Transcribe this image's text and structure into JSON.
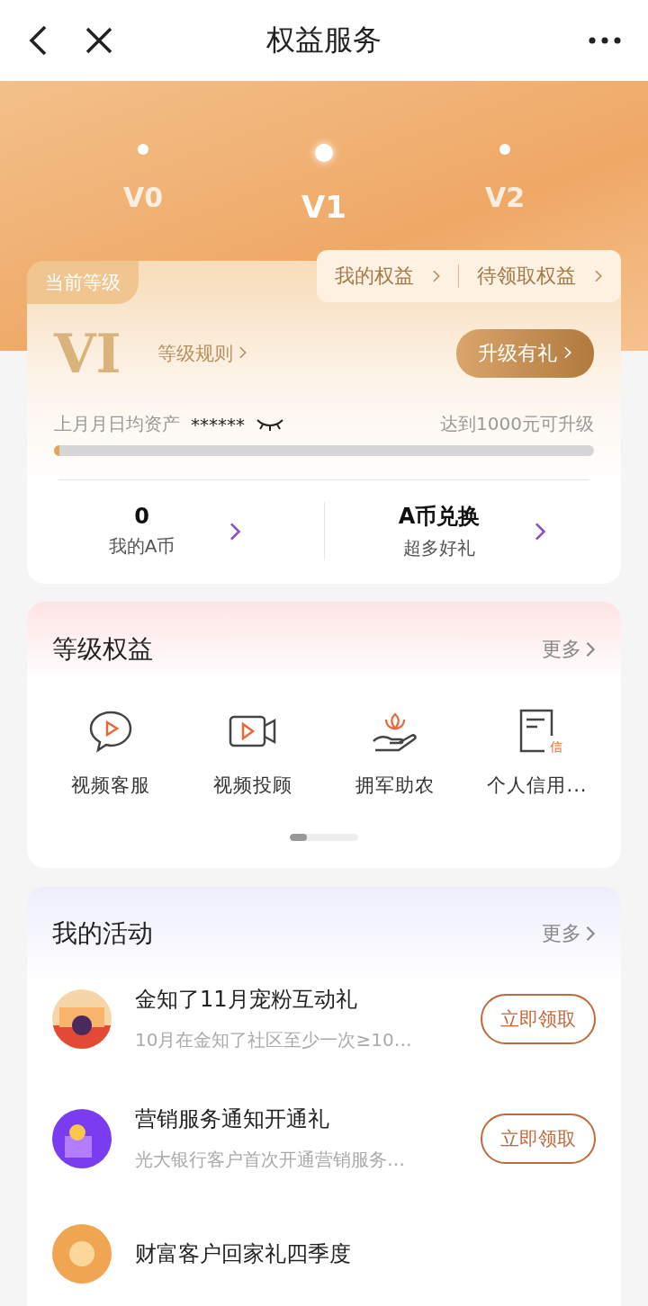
{
  "nav": {
    "title": "权益服务"
  },
  "levels": [
    {
      "label": "V0",
      "selected": false
    },
    {
      "label": "V1",
      "selected": true
    },
    {
      "label": "V2",
      "selected": false
    }
  ],
  "card": {
    "badge": "当前等级",
    "links": [
      "我的权益",
      "待领取权益"
    ],
    "level": "VI",
    "rules": "等级规则",
    "upgrade": "升级有礼",
    "asset_label": "上月月日均资产",
    "asset_value": "******",
    "target": "达到1000元可升级",
    "progress": {
      "level": 0.01
    },
    "stats": [
      {
        "value": "0",
        "label": "我的A币"
      },
      {
        "value": "A币兑换",
        "label": "超多好礼"
      }
    ]
  },
  "benefits": {
    "title": "等级权益",
    "more": "更多",
    "items": [
      {
        "kind": "chat-video",
        "label": "视频客服"
      },
      {
        "kind": "camera",
        "label": "视频投顾"
      },
      {
        "kind": "hand",
        "label": "拥军助农"
      },
      {
        "kind": "doc",
        "label": "个人信用...",
        "mark": "信"
      }
    ],
    "pager": {
      "level": 0.25
    }
  },
  "activities": {
    "title": "我的活动",
    "more": "更多",
    "items": [
      {
        "title": "金知了11月宠粉互动礼",
        "desc": "10月在金知了社区至少一次≥10…",
        "button": "立即领取",
        "kind": "picture"
      },
      {
        "title": "营销服务通知开通礼",
        "desc": "光大银行客户首次开通营销服务…",
        "button": "立即领取",
        "kind": "picture"
      },
      {
        "title": "财富客户回家礼四季度",
        "kind": "picture"
      }
    ]
  }
}
